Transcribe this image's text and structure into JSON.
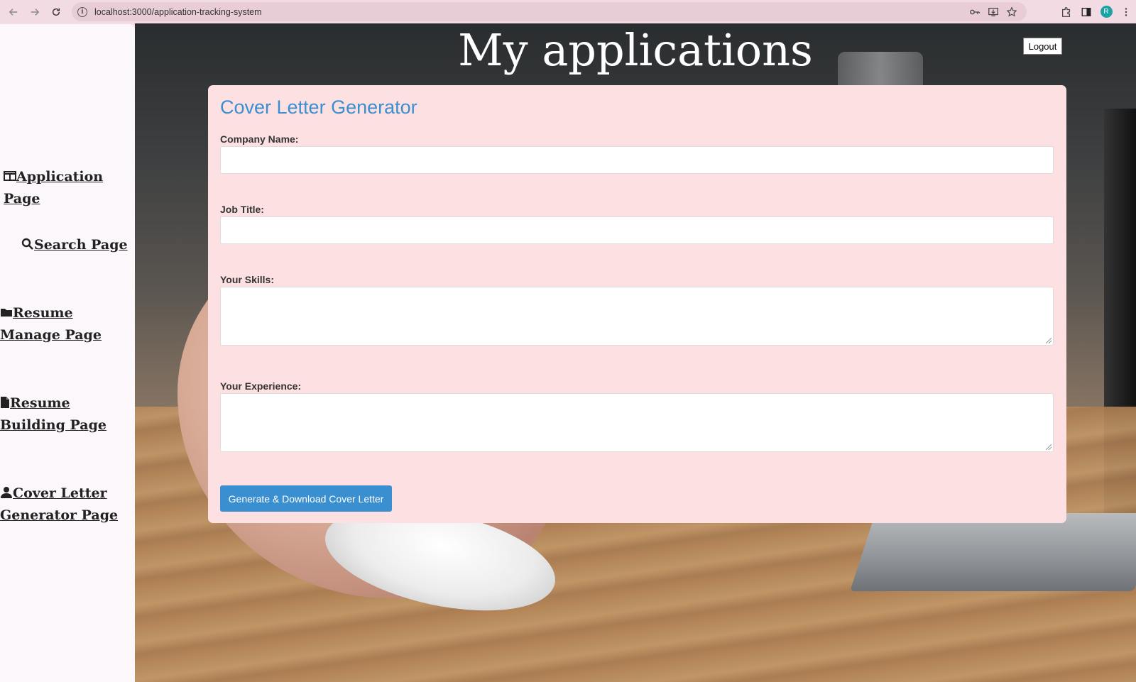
{
  "browser": {
    "url": "localhost:3000/application-tracking-system",
    "profile_initial": "R"
  },
  "page": {
    "title": "My applications",
    "logout_label": "Logout"
  },
  "sidebar": {
    "items": [
      {
        "label": "Application Page",
        "icon": "table-icon"
      },
      {
        "label": "Search Page",
        "icon": "search-icon"
      },
      {
        "label": "Resume Manage Page",
        "icon": "folder-icon"
      },
      {
        "label": "Resume Building Page",
        "icon": "file-icon"
      },
      {
        "label": "Cover Letter Generator Page",
        "icon": "user-icon"
      }
    ]
  },
  "form": {
    "title": "Cover Letter Generator",
    "company_label": "Company Name:",
    "company_value": "",
    "job_title_label": "Job Title:",
    "job_title_value": "",
    "skills_label": "Your Skills:",
    "skills_value": "",
    "experience_label": "Your Experience:",
    "experience_value": "",
    "submit_label": "Generate & Download Cover Letter"
  },
  "colors": {
    "accent": "#3a8fd1",
    "panel_bg": "#fde0e1",
    "sidebar_bg": "#fcf7fa"
  }
}
